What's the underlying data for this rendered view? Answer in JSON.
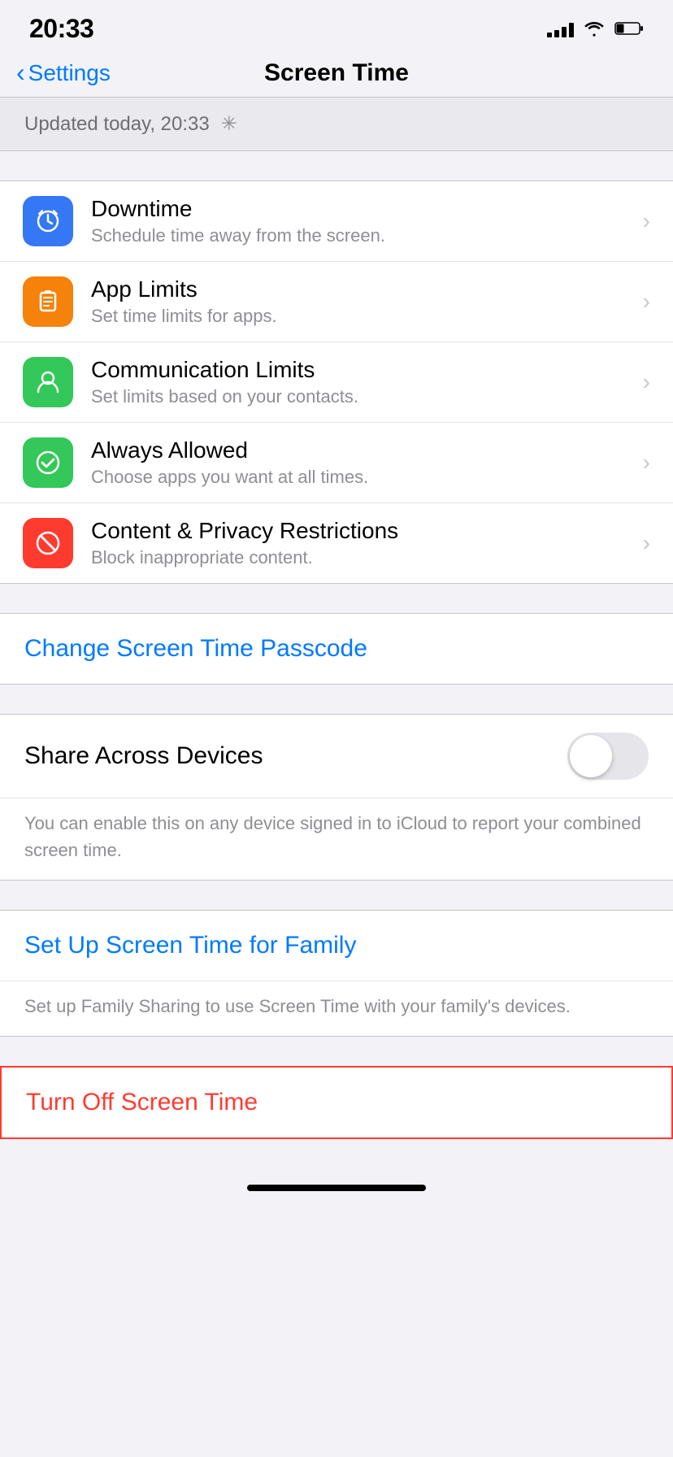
{
  "statusBar": {
    "time": "20:33",
    "signal_bars": [
      3,
      5,
      7,
      10,
      12
    ],
    "battery_level": 30
  },
  "nav": {
    "back_label": "Settings",
    "title": "Screen Time"
  },
  "update_banner": {
    "text": "Updated today, 20:33"
  },
  "menu_items": [
    {
      "title": "Downtime",
      "subtitle": "Schedule time away from the screen.",
      "icon_color": "bg-blue",
      "icon": "downtime"
    },
    {
      "title": "App Limits",
      "subtitle": "Set time limits for apps.",
      "icon_color": "bg-orange",
      "icon": "app-limits"
    },
    {
      "title": "Communication Limits",
      "subtitle": "Set limits based on your contacts.",
      "icon_color": "bg-green-teal",
      "icon": "communication"
    },
    {
      "title": "Always Allowed",
      "subtitle": "Choose apps you want at all times.",
      "icon_color": "bg-green",
      "icon": "always-allowed"
    },
    {
      "title": "Content & Privacy Restrictions",
      "subtitle": "Block inappropriate content.",
      "icon_color": "bg-red",
      "icon": "content-privacy"
    }
  ],
  "change_passcode": {
    "label": "Change Screen Time Passcode"
  },
  "share_devices": {
    "title": "Share Across Devices",
    "description": "You can enable this on any device signed in to iCloud to report your combined screen time.",
    "toggle_on": false
  },
  "family": {
    "label": "Set Up Screen Time for Family",
    "description": "Set up Family Sharing to use Screen Time with your family's devices."
  },
  "turn_off": {
    "label": "Turn Off Screen Time"
  }
}
